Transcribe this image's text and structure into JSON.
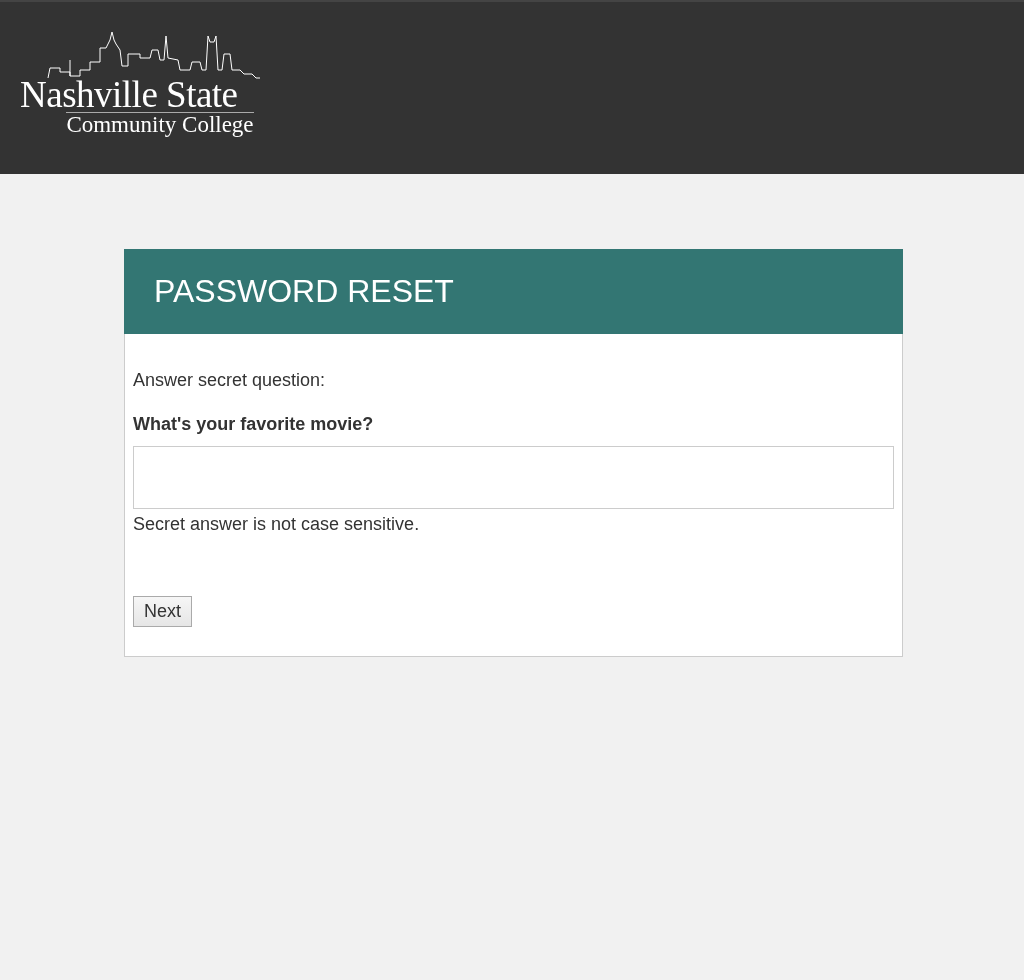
{
  "header": {
    "logo": {
      "line_1": "Nashville State",
      "line_2": "Community College"
    }
  },
  "card": {
    "title": "PASSWORD RESET",
    "intro": "Answer secret question:",
    "question": "What's your favorite movie?",
    "hint": "Secret answer is not case sensitive.",
    "button": "Next"
  }
}
